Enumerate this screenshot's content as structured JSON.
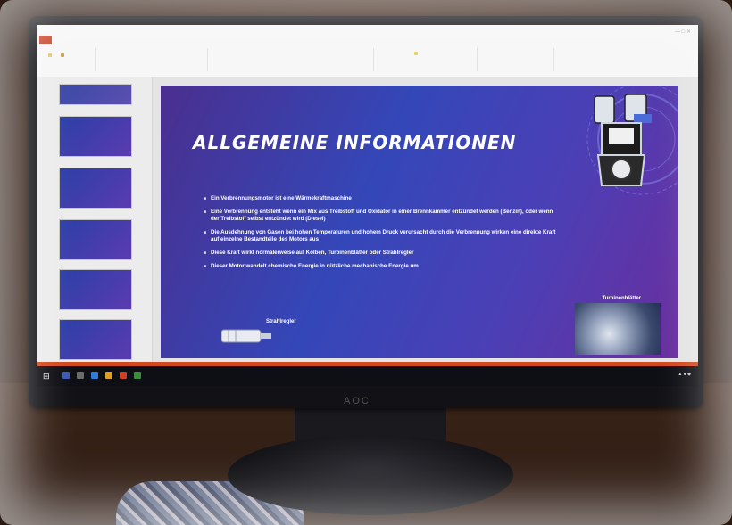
{
  "slide": {
    "title": "ALLGEMEINE INFORMATIONEN",
    "bullets": [
      "Ein Verbrennungsmotor ist eine Wärmekraftmaschine",
      "Eine Verbrennung entsteht wenn ein Mix aus Treibstoff und Oxidator in einer Brennkammer entzündet werden (Benzin), oder wenn der Treibstoff selbst entzündet wird (Diesel)",
      "Die Ausdehnung von Gasen bei hohen Temperaturen und hohem Druck verursacht durch die Verbrennung wirken eine direkte Kraft auf einzelne Bestandteile des Motors aus",
      "Diese Kraft wirkt normalerweise auf Kolben, Turbinenblätter oder Strahlregler",
      "Dieser Motor wandelt chemische Energie in nützliche mechanische Energie um"
    ],
    "caption_right": "Turbinenblätter",
    "caption_left": "Strahlregler"
  },
  "monitor": {
    "brand": "AOC"
  },
  "icons": {
    "start": "windows-start-icon",
    "engine": "engine-cylinder-icon"
  },
  "colors": {
    "slide_start": "#4a2f8f",
    "slide_mid": "#3447b8",
    "accent_orange": "#d2481f",
    "taskbar": "#0e0f14"
  }
}
